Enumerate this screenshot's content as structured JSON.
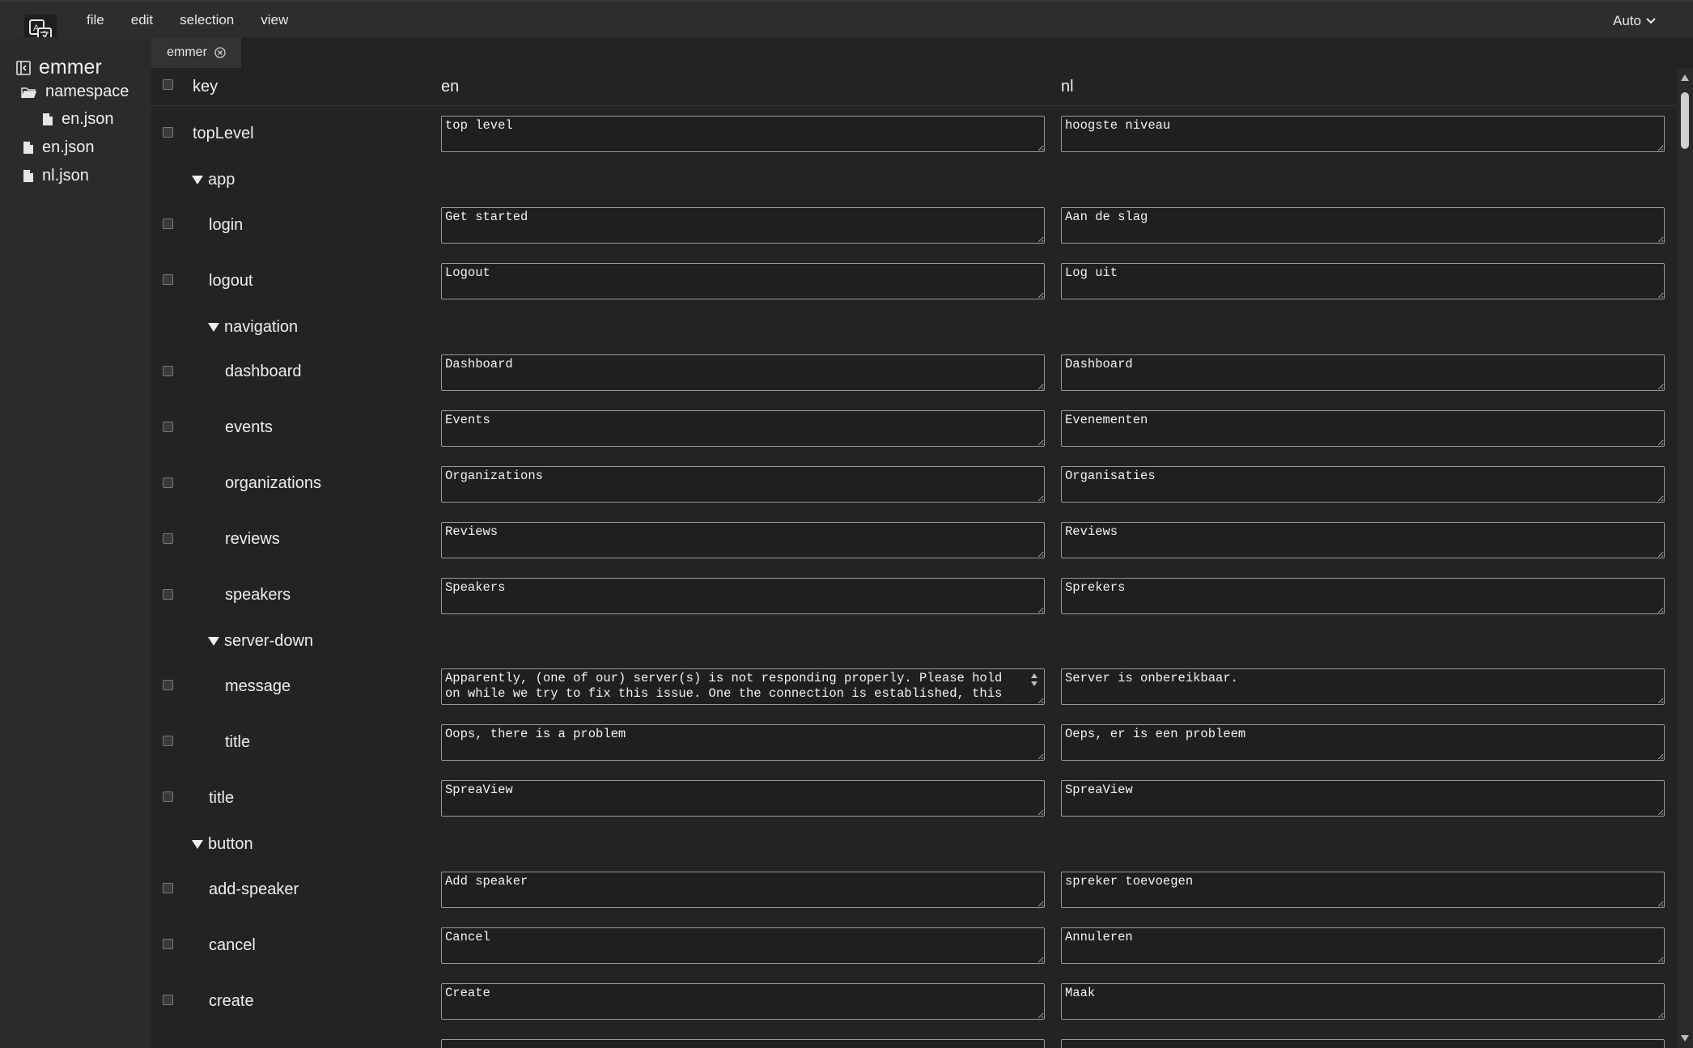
{
  "menu": {
    "file": "file",
    "edit": "edit",
    "selection": "selection",
    "view": "view",
    "auto": "Auto"
  },
  "sidebar": {
    "root": "emmer",
    "namespace": "namespace",
    "ns_file": "en.json",
    "file_en": "en.json",
    "file_nl": "nl.json"
  },
  "tab": {
    "label": "emmer"
  },
  "header": {
    "key": "key",
    "en": "en",
    "nl": "nl"
  },
  "rows": {
    "topLevel": {
      "key": "topLevel",
      "en": "top level",
      "nl": "hoogste niveau"
    },
    "app": "app",
    "login": {
      "key": "login",
      "en": "Get started",
      "nl": "Aan de slag"
    },
    "logout": {
      "key": "logout",
      "en": "Logout",
      "nl": "Log uit"
    },
    "navigation": "navigation",
    "dashboard": {
      "key": "dashboard",
      "en": "Dashboard",
      "nl": "Dashboard"
    },
    "events": {
      "key": "events",
      "en": "Events",
      "nl": "Evenementen"
    },
    "organizations": {
      "key": "organizations",
      "en": "Organizations",
      "nl": "Organisaties"
    },
    "reviews": {
      "key": "reviews",
      "en": "Reviews",
      "nl": "Reviews"
    },
    "speakers": {
      "key": "speakers",
      "en": "Speakers",
      "nl": "Sprekers"
    },
    "server_down": "server-down",
    "message": {
      "key": "message",
      "en": "Apparently, (one of our) server(s) is not responding properly. Please hold on while we try to fix this issue. One the connection is established, this",
      "nl": "Server is onbereikbaar."
    },
    "sd_title": {
      "key": "title",
      "en": "Oops, there is a problem",
      "nl": "Oeps, er is een probleem"
    },
    "title": {
      "key": "title",
      "en": "SpreaView",
      "nl": "SpreaView"
    },
    "button": "button",
    "add_speaker": {
      "key": "add-speaker",
      "en": "Add speaker",
      "nl": "spreker toevoegen"
    },
    "cancel": {
      "key": "cancel",
      "en": "Cancel",
      "nl": "Annuleren"
    },
    "create": {
      "key": "create",
      "en": "Create",
      "nl": "Maak"
    }
  }
}
